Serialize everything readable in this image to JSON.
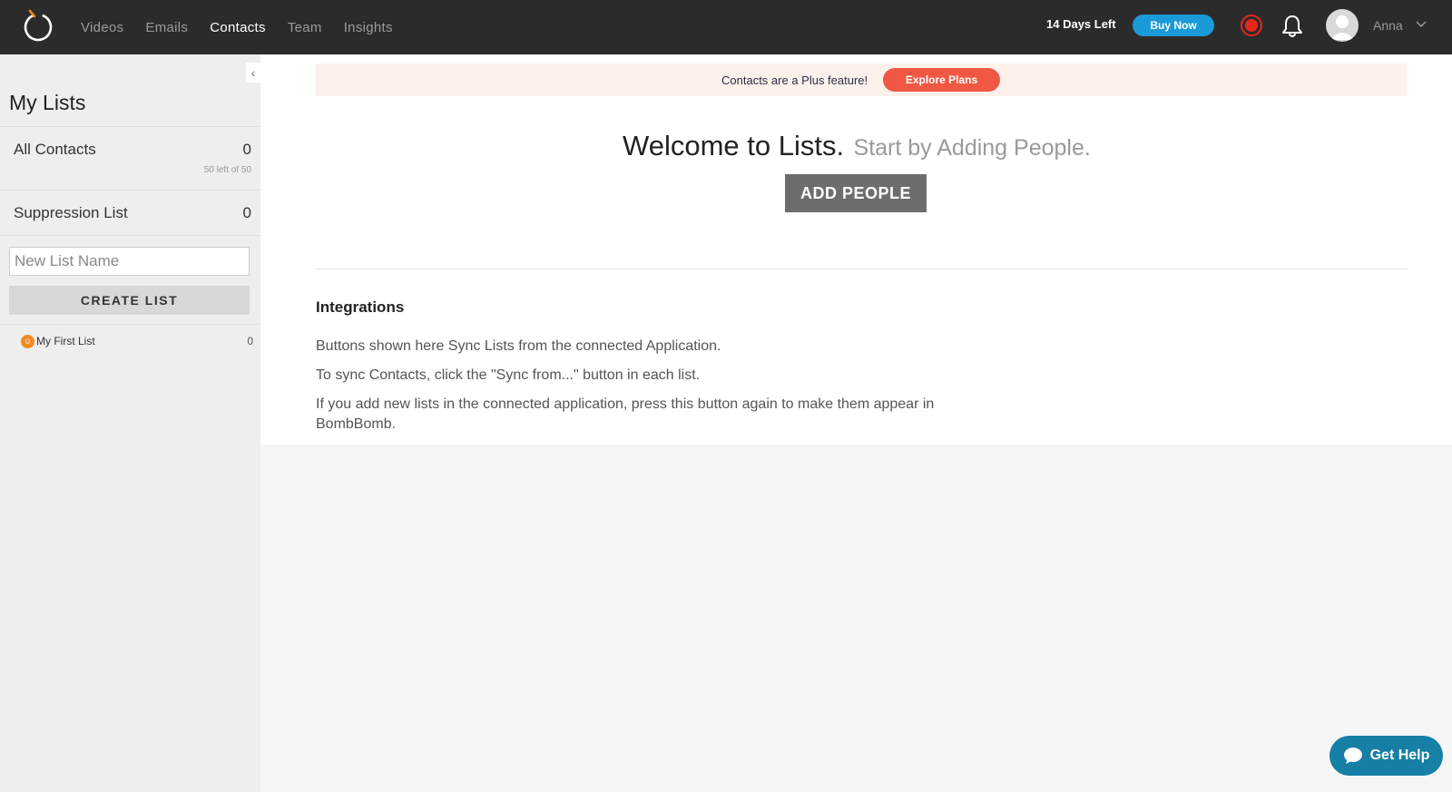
{
  "nav": {
    "items": [
      {
        "label": "Videos",
        "active": false
      },
      {
        "label": "Emails",
        "active": false
      },
      {
        "label": "Contacts",
        "active": true
      },
      {
        "label": "Team",
        "active": false
      },
      {
        "label": "Insights",
        "active": false
      }
    ],
    "trial_text": "14 Days Left",
    "buy_now_label": "Buy Now",
    "user_name": "Anna",
    "icons": [
      "logo-icon",
      "record-icon",
      "bell-icon",
      "avatar",
      "chevron-down-icon"
    ]
  },
  "sidebar": {
    "collapse_icon": "‹",
    "title": "My Lists",
    "all_contacts": {
      "label": "All Contacts",
      "count": "0",
      "quota": "50 left of 50"
    },
    "suppression": {
      "label": "Suppression List",
      "count": "0"
    },
    "new_list_placeholder": "New List Name",
    "create_list_label": "CREATE LIST",
    "lists": [
      {
        "name": "My First List",
        "count": "0",
        "badge_icon": "smiley-icon"
      }
    ]
  },
  "main": {
    "promo_text": "Contacts are a Plus feature!",
    "explore_label": "Explore Plans",
    "welcome_title": "Welcome to Lists.",
    "welcome_sub": "Start by Adding People.",
    "add_people_label": "ADD PEOPLE",
    "integrations": {
      "heading": "Integrations",
      "lines": [
        "Buttons shown here Sync Lists from the connected Application.",
        "To sync Contacts, click the \"Sync from...\" button in each list.",
        "If you add new lists in the connected application, press this button again to make them appear in",
        "BombBomb."
      ]
    }
  },
  "help": {
    "label": "Get Help",
    "icon": "chat-bubble-icon"
  },
  "colors": {
    "topbar": "#2b2b2b",
    "buy_now": "#1a9ad6",
    "record": "#e8241d",
    "explore": "#f05843",
    "promo_bg": "#fdf1ec",
    "add_people": "#6d6d6d",
    "get_help": "#157fa6"
  }
}
